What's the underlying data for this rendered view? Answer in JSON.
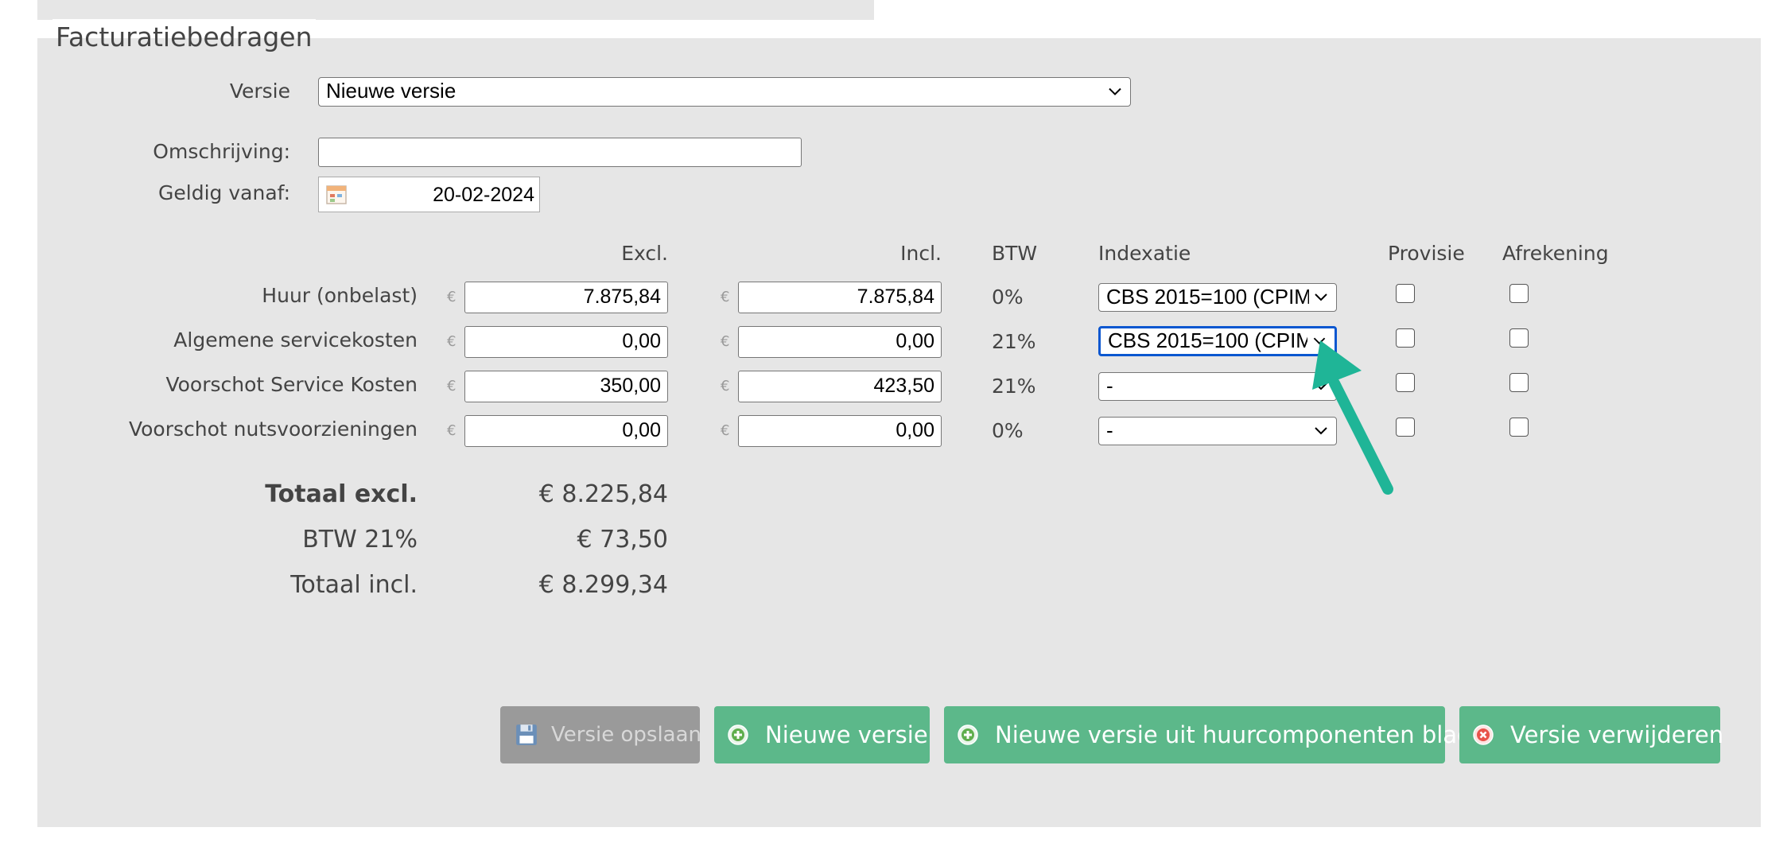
{
  "section_title": "Facturatiebedragen",
  "versie": {
    "label": "Versie",
    "value": "Nieuwe versie"
  },
  "omschrijving": {
    "label": "Omschrijving:",
    "value": ""
  },
  "geldig_vanaf": {
    "label": "Geldig vanaf:",
    "value": "20-02-2024"
  },
  "columns": {
    "excl": "Excl.",
    "incl": "Incl.",
    "btw": "BTW",
    "indexatie": "Indexatie",
    "provisie": "Provisie",
    "afrekening": "Afrekening"
  },
  "currency_symbol": "€",
  "rows": [
    {
      "label": "Huur (onbelast)",
      "excl": "7.875,84",
      "incl": "7.875,84",
      "btw": "0%",
      "indexatie": "CBS 2015=100 (CPIM",
      "provisie": false,
      "afrekening": false
    },
    {
      "label": "Algemene servicekosten",
      "excl": "0,00",
      "incl": "0,00",
      "btw": "21%",
      "indexatie": "CBS 2015=100 (CPIM",
      "provisie": false,
      "afrekening": false
    },
    {
      "label": "Voorschot Service Kosten",
      "excl": "350,00",
      "incl": "423,50",
      "btw": "21%",
      "indexatie": "-",
      "provisie": false,
      "afrekening": false
    },
    {
      "label": "Voorschot nutsvoorzieningen",
      "excl": "0,00",
      "incl": "0,00",
      "btw": "0%",
      "indexatie": "-",
      "provisie": false,
      "afrekening": false
    }
  ],
  "totals": [
    {
      "label": "Totaal excl.",
      "value": "€ 8.225,84"
    },
    {
      "label": "BTW 21%",
      "value": "€ 73,50"
    },
    {
      "label": "Totaal incl.",
      "value": "€ 8.299,34"
    }
  ],
  "buttons": {
    "save": "Versie opslaan",
    "new": "Nieuwe versie",
    "new_from_sheet": "Nieuwe versie uit huurcomponenten blad",
    "delete": "Versie verwijderen"
  },
  "icons": {
    "calendar": "calendar-icon",
    "save": "floppy-disk-icon",
    "add": "plus-circle-icon",
    "remove": "x-circle-icon",
    "pointer": "arrow-pointer-icon"
  },
  "colors": {
    "panel_bg": "#e6e6e6",
    "button_green": "#5cb88a",
    "button_disabled": "#9a9a9a",
    "focus_blue": "#0b57d0",
    "arrow_teal": "#1fb597",
    "delete_red": "#e8534b"
  }
}
